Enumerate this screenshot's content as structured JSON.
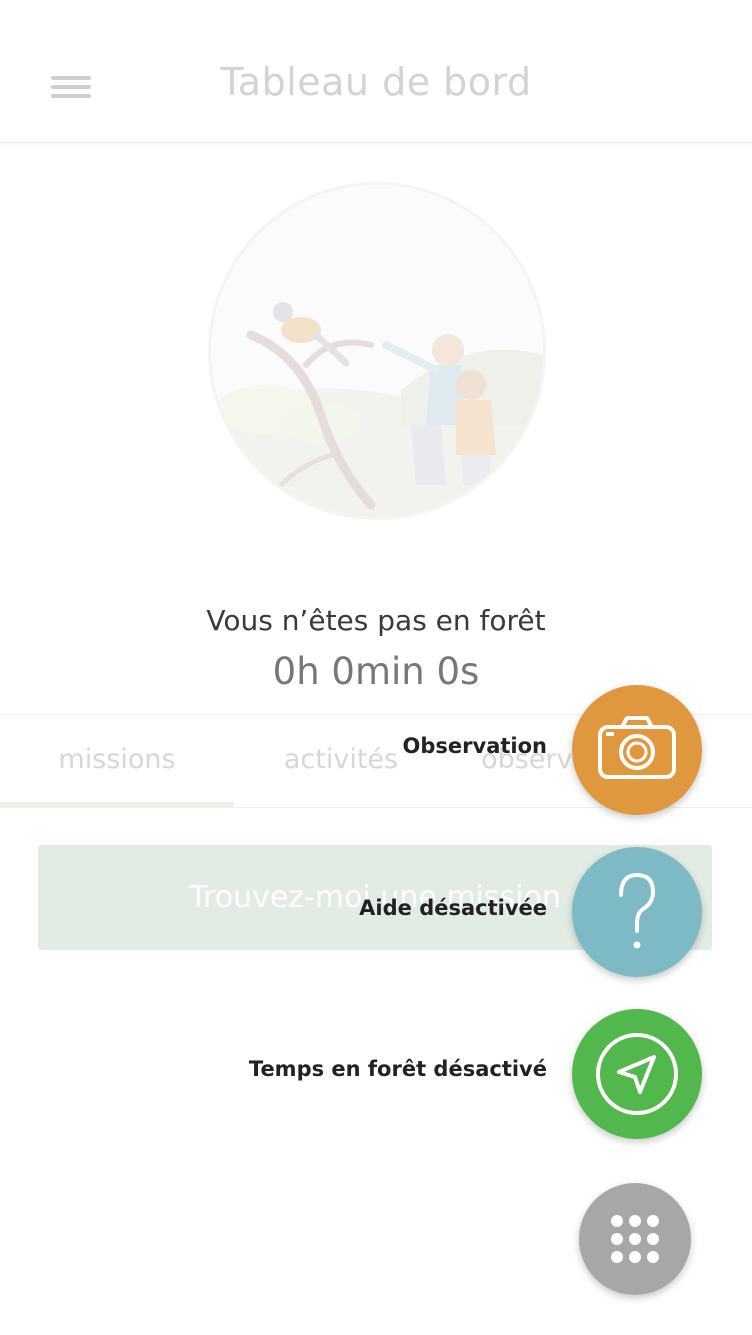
{
  "header": {
    "title": "Tableau de bord",
    "menu_icon": "hamburger-menu-icon"
  },
  "hero": {
    "illustration": "birdwatchers-illustration"
  },
  "status": {
    "forest_text": "Vous n’êtes pas en forêt",
    "timer": "0h 0min 0s"
  },
  "tabs": [
    {
      "label": "missions",
      "active": true
    },
    {
      "label": "activités",
      "active": false
    },
    {
      "label": "observations",
      "active": false
    }
  ],
  "mission_button": {
    "label": "Trouvez-moi une mission"
  },
  "fab_menu": {
    "items": [
      {
        "label": "Observation",
        "icon": "camera-icon",
        "color": "#E0983F"
      },
      {
        "label": "Aide désactivée",
        "icon": "question-mark-icon",
        "color": "#7EBAC5"
      },
      {
        "label": "Temps en forêt désactivé",
        "icon": "navigation-arrow-icon",
        "color": "#52B74C"
      }
    ],
    "main_icon": "grid-dots-icon",
    "main_color": "#A7A7A7"
  },
  "colors": {
    "accent_green": "#52B74C",
    "accent_orange": "#E0983F",
    "accent_blue": "#7EBAC5"
  }
}
